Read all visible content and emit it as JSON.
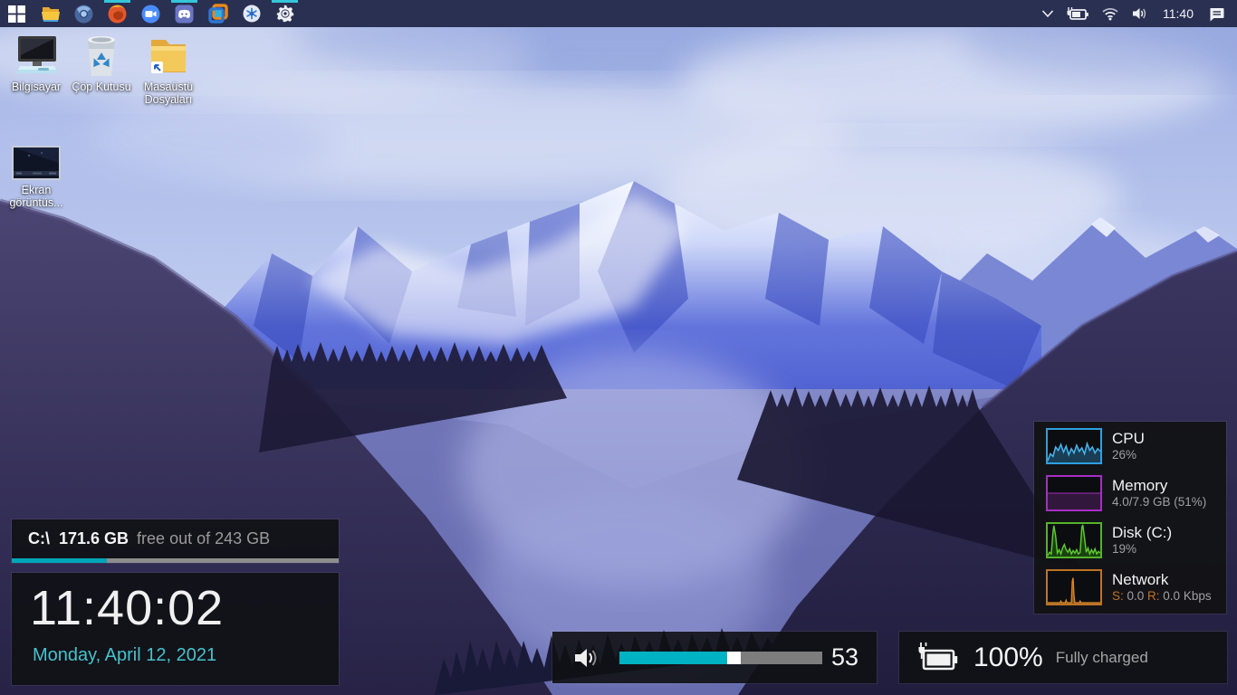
{
  "colors": {
    "accent": "#35c6d9",
    "taskbar_bg": "#2a3051",
    "disk_bar_teal": "#00a7b8",
    "volume_teal": "#00b2c3",
    "date_teal": "#44c3cd",
    "cpu": "#2ea0e0",
    "memory": "#a62ec4",
    "disk": "#54b32a",
    "network": "#bf7326"
  },
  "taskbar": {
    "time": "11:40",
    "pinned": [
      {
        "name": "start",
        "active": false
      },
      {
        "name": "file-explorer",
        "active": false
      },
      {
        "name": "chromium-browser",
        "active": false
      },
      {
        "name": "firefox",
        "active": true
      },
      {
        "name": "zoom",
        "active": false
      },
      {
        "name": "discord",
        "active": true
      },
      {
        "name": "vmware",
        "active": false
      },
      {
        "name": "sphere-app",
        "active": false
      },
      {
        "name": "settings",
        "active": true
      }
    ],
    "tray": [
      "chevron",
      "battery",
      "wifi",
      "volume",
      "clock",
      "action-center"
    ]
  },
  "desktop_icons": [
    {
      "label": "Bilgisayar",
      "icon": "computer"
    },
    {
      "label": "Çöp Kutusu",
      "icon": "recycle-bin"
    },
    {
      "label": "Masaüstü Dosyaları",
      "icon": "folder-shortcut"
    },
    {
      "label": "Ekran görüntüs...",
      "icon": "screenshot-thumbnail"
    }
  ],
  "widgets": {
    "disk": {
      "drive": "C:\\",
      "free_value": "171.6 GB",
      "free_text": "free out of 243 GB",
      "used_pct": 29
    },
    "clock": {
      "time": "11:40:02",
      "date": "Monday, April 12, 2021"
    },
    "volume": {
      "value": "53",
      "pct": 53
    },
    "battery": {
      "percent": "100%",
      "status": "Fully charged"
    },
    "monitor": {
      "rows": [
        {
          "label": "CPU",
          "value": "26%",
          "color": "#2ea0e0"
        },
        {
          "label": "Memory",
          "value": "4.0/7.9 GB (51%)",
          "color": "#a62ec4"
        },
        {
          "label": "Disk (C:)",
          "value": "19%",
          "color": "#54b32a"
        },
        {
          "label": "Network",
          "color": "#bf7326",
          "s_label": "S:",
          "s_value": " 0.0 ",
          "r_label": "R:",
          "r_value": " 0.0 Kbps"
        }
      ]
    }
  }
}
